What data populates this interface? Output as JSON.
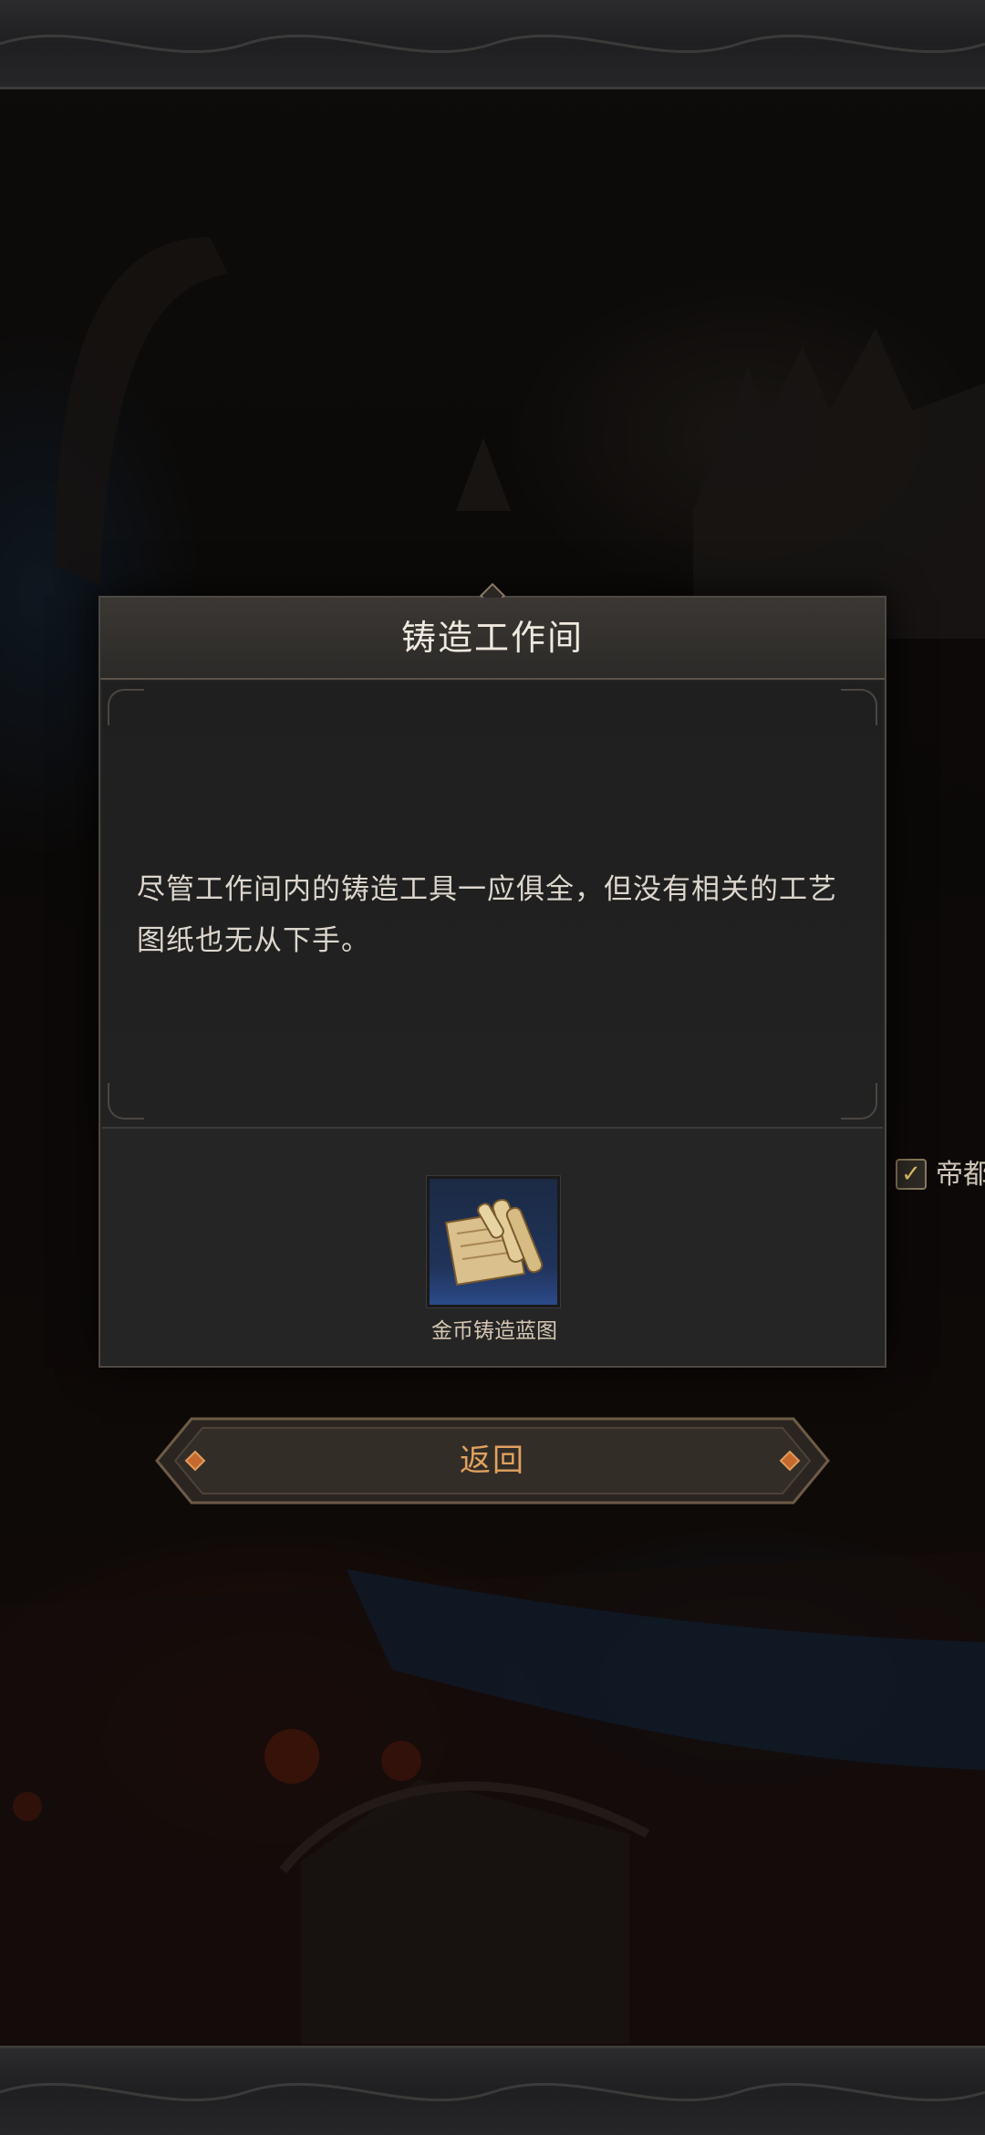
{
  "dialog": {
    "title": "铸造工作间",
    "description": "尽管工作间内的铸造工具一应俱全，但没有相关的工艺图纸也无从下手。",
    "item": {
      "icon": "scroll-blueprint-icon",
      "label": "金币铸造蓝图"
    }
  },
  "back_button": {
    "label": "返回"
  },
  "side_tag": {
    "check_icon": "check-icon",
    "label": "帝都"
  },
  "colors": {
    "button_text": "#e0a15e",
    "title_text": "#efe9df",
    "body_text": "#dcd6cd",
    "item_slot_blue": "#2b4a8a"
  }
}
